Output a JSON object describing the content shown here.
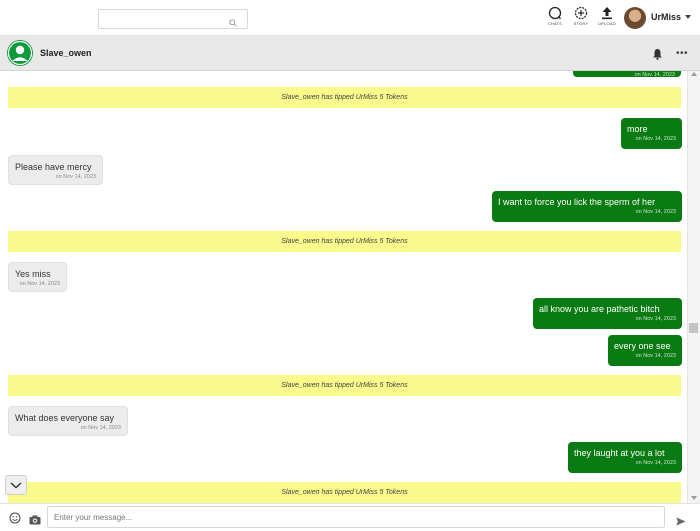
{
  "topbar": {
    "search_placeholder": "",
    "buttons": [
      {
        "label": "CHATS",
        "icon": "chat-bubble-icon"
      },
      {
        "label": "STORY",
        "icon": "story-plus-icon"
      },
      {
        "label": "UPLOAD",
        "icon": "upload-icon"
      }
    ],
    "user_name": "UrMiss"
  },
  "chat_header": {
    "contact_name": "Slave_owen",
    "icons": [
      "bell-icon",
      "more-icon"
    ]
  },
  "messages": [
    {
      "type": "out",
      "text": "",
      "time": "on Nov 14, 2023"
    },
    {
      "type": "tip",
      "text": "Slave_owen has tipped UrMiss 5 Tokens"
    },
    {
      "type": "out",
      "text": "more",
      "time": "on Nov 14, 2023"
    },
    {
      "type": "in",
      "text": "Please have mercy",
      "time": "on Nov 14, 2023"
    },
    {
      "type": "out",
      "text": "I want to force you lick the sperm of her",
      "time": "on Nov 14, 2023"
    },
    {
      "type": "tip",
      "text": "Slave_owen has tipped UrMiss 5 Tokens"
    },
    {
      "type": "in",
      "text": "Yes miss",
      "time": "on Nov 14, 2023"
    },
    {
      "type": "out",
      "text": "all know you are pathetic bitch",
      "time": "on Nov 14, 2023"
    },
    {
      "type": "out",
      "text": "every one see",
      "time": "on Nov 14, 2023"
    },
    {
      "type": "tip",
      "text": "Slave_owen has tipped UrMiss 5 Tokens"
    },
    {
      "type": "in",
      "text": "What does everyone say",
      "time": "on Nov 14, 2023"
    },
    {
      "type": "out",
      "text": "they laught at you a lot",
      "time": "on Nov 14, 2023"
    },
    {
      "type": "tip",
      "text": "Slave_owen has tipped UrMiss 5 Tokens"
    }
  ],
  "composer": {
    "placeholder": "Enter your message..."
  },
  "colors": {
    "outgoing": "#0a7a12",
    "incoming": "#ececec",
    "tip": "#fafa8c",
    "avatar_green": "#0f9b3c"
  }
}
